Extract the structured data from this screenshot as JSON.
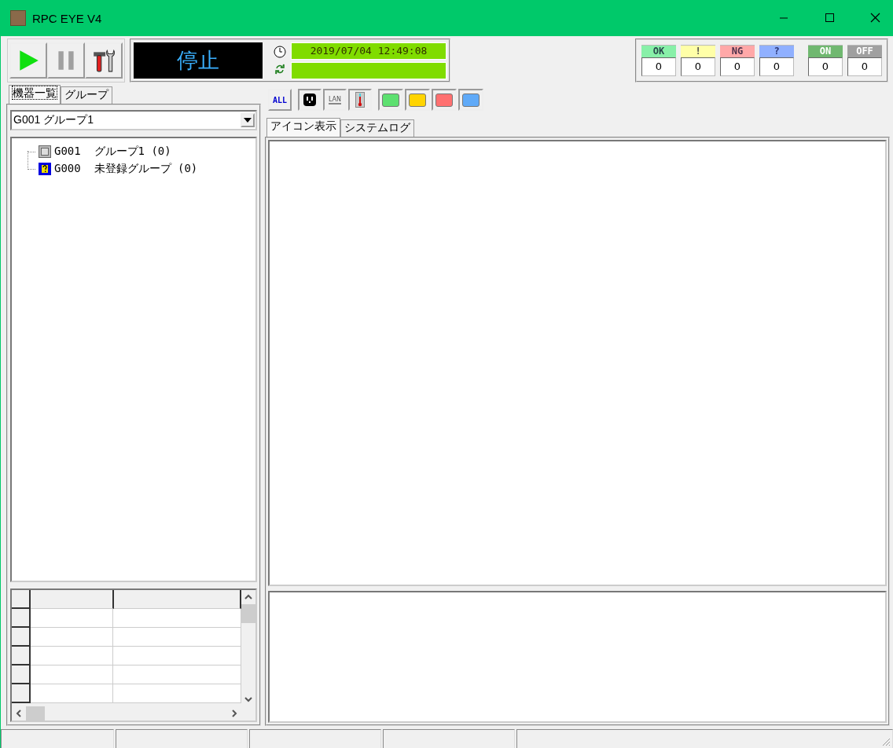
{
  "window": {
    "title": "RPC EYE V4"
  },
  "run_state": {
    "text": "停止"
  },
  "clock": {
    "datetime": "2019/07/04 12:49:08"
  },
  "counters": [
    {
      "label": "OK",
      "value": "0",
      "color": "#88f0a8"
    },
    {
      "label": "!",
      "value": "0",
      "color": "#ffffa8"
    },
    {
      "label": "NG",
      "value": "0",
      "color": "#ffa8a8"
    },
    {
      "label": "?",
      "value": "0",
      "color": "#90b0ff"
    },
    {
      "label": "ON",
      "value": "0",
      "color": "#70b870"
    },
    {
      "label": "OFF",
      "value": "0",
      "color": "#a0a0a0"
    }
  ],
  "left_tabs": [
    {
      "label": "機器一覧",
      "selected": true
    },
    {
      "label": "グループ",
      "selected": false
    }
  ],
  "group_select": {
    "value": "G001 グループ1"
  },
  "tree": [
    {
      "kind": "group",
      "code": "G001",
      "name": "グループ1 (0)"
    },
    {
      "kind": "unregistered",
      "code": "G000",
      "name": "未登録グループ (0)"
    }
  ],
  "filters": {
    "all": "ALL",
    "lan": "LAN",
    "colors": [
      {
        "color": "#5de070"
      },
      {
        "color": "#ffd400"
      },
      {
        "color": "#ff7070"
      },
      {
        "color": "#60aaf8"
      }
    ]
  },
  "right_tabs": [
    {
      "label": "アイコン表示",
      "selected": true
    },
    {
      "label": "システムログ",
      "selected": false
    }
  ]
}
